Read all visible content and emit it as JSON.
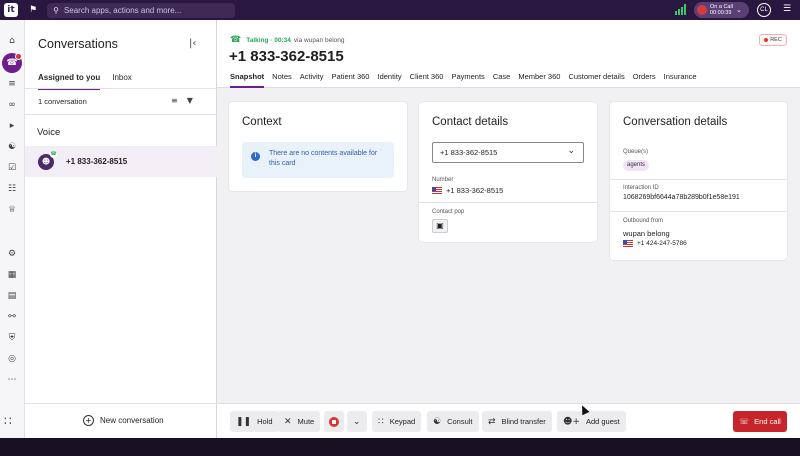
{
  "topbar": {
    "logo": "it",
    "search_placeholder": "Search apps, actions and more...",
    "on_call_label": "On a Call",
    "on_call_timer": "00:00:39",
    "user_initials": "CL"
  },
  "rail": {
    "icons": [
      "home-icon",
      "conversations-icon",
      "list-icon",
      "voicemail-icon",
      "campaign-icon",
      "contacts-icon",
      "tasks-icon",
      "org-icon",
      "trophy-icon",
      "settings-icon",
      "directory-icon",
      "book-icon",
      "flow-icon",
      "shield-icon",
      "fingerprint-icon",
      "more-icon",
      "apps-grid-icon"
    ]
  },
  "conversations": {
    "title": "Conversations",
    "tabs": [
      "Assigned to you",
      "Inbox"
    ],
    "count_label": "1 conversation",
    "section": "Voice",
    "items": [
      {
        "number": "+1 833-362-8515"
      }
    ],
    "new_button": "New conversation"
  },
  "call": {
    "status": "Talking · 00:34",
    "via": "via wupan belong",
    "number": "+1 833-362-8515",
    "rec": "REC",
    "tabs": [
      "Snapshot",
      "Notes",
      "Activity",
      "Patient 360",
      "Identity",
      "Client 360",
      "Payments",
      "Case",
      "Member 360",
      "Customer details",
      "Orders",
      "Insurance"
    ]
  },
  "context_card": {
    "title": "Context",
    "message": "There are no contents available for this card"
  },
  "contact_card": {
    "title": "Contact details",
    "selected": "+1 833-362-8515",
    "number_label": "Number",
    "number_value": "+1 833-362-8515",
    "pop_label": "Contact pop"
  },
  "conversation_card": {
    "title": "Conversation details",
    "queue_label": "Queue(s)",
    "queue_value": "agents",
    "interaction_label": "Interaction ID",
    "interaction_value": "1068269bf6644a78b289b0f1e58e191",
    "outbound_label": "Outbound from",
    "outbound_name": "wupan belong",
    "outbound_number": "+1 424-247-5786"
  },
  "actions": {
    "hold": "Hold",
    "mute": "Mute",
    "keypad": "Keypad",
    "consult": "Consult",
    "blind_transfer": "Blind transfer",
    "add_guest": "Add guest",
    "end_call": "End call"
  },
  "colors": {
    "brand": "#6c1e8b",
    "topbar": "#2a1740",
    "talking": "#2da55a",
    "end_call": "#c8242c",
    "info": "#e9f1fb"
  }
}
